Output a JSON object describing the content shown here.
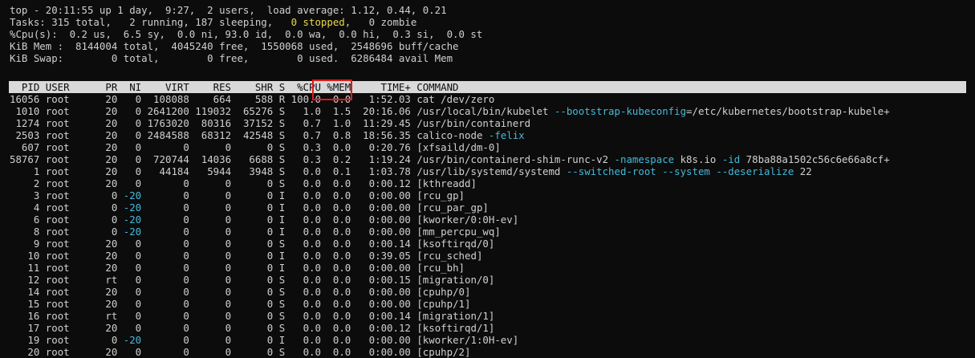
{
  "summary": {
    "l1": "top - 20:11:55 up 1 day,  9:27,  2 users,  load average: 1.12, 0.44, 0.21",
    "l2_pre": "Tasks: 315 total,   2 running, 187 sleeping,   ",
    "l2_stopped": "0 stopped",
    "l2_post": ",   0 zombie",
    "l3": "%Cpu(s):  0.2 us,  6.5 sy,  0.0 ni, 93.0 id,  0.0 wa,  0.0 hi,  0.3 si,  0.0 st",
    "l4": "KiB Mem :  8144004 total,  4045240 free,  1550068 used,  2548696 buff/cache",
    "l5": "KiB Swap:        0 total,        0 free,        0 used.  6286484 avail Mem"
  },
  "header": "  PID USER      PR  NI    VIRT    RES    SHR S  %CPU %MEM     TIME+ COMMAND",
  "rows": [
    {
      "pid": "16056",
      "user": "root",
      "pr": "20",
      "ni": "0",
      "virt": "108088",
      "res": "664",
      "shr": "588",
      "s": "R",
      "cpu": "100.0",
      "mem": "0.0",
      "time": "1:52.03",
      "cmd": [
        {
          "t": "cat /dev/zero",
          "c": ""
        }
      ]
    },
    {
      "pid": "1010",
      "user": "root",
      "pr": "20",
      "ni": "0",
      "virt": "2641200",
      "res": "119032",
      "shr": "65276",
      "s": "S",
      "cpu": "1.0",
      "mem": "1.5",
      "time": "20:16.06",
      "cmd": [
        {
          "t": "/usr/local/bin/kubelet ",
          "c": ""
        },
        {
          "t": "--bootstrap-kubeconfig",
          "c": "cyan"
        },
        {
          "t": "=/etc/kubernetes/bootstrap-kubele+",
          "c": ""
        }
      ]
    },
    {
      "pid": "1274",
      "user": "root",
      "pr": "20",
      "ni": "0",
      "virt": "1763020",
      "res": "80316",
      "shr": "37152",
      "s": "S",
      "cpu": "0.7",
      "mem": "1.0",
      "time": "11:29.45",
      "cmd": [
        {
          "t": "/usr/bin/containerd",
          "c": ""
        }
      ]
    },
    {
      "pid": "2503",
      "user": "root",
      "pr": "20",
      "ni": "0",
      "virt": "2484588",
      "res": "68312",
      "shr": "42548",
      "s": "S",
      "cpu": "0.7",
      "mem": "0.8",
      "time": "18:56.35",
      "cmd": [
        {
          "t": "calico-node ",
          "c": ""
        },
        {
          "t": "-felix",
          "c": "cyan"
        }
      ]
    },
    {
      "pid": "607",
      "user": "root",
      "pr": "20",
      "ni": "0",
      "virt": "0",
      "res": "0",
      "shr": "0",
      "s": "S",
      "cpu": "0.3",
      "mem": "0.0",
      "time": "0:20.76",
      "cmd": [
        {
          "t": "[xfsaild/dm-0]",
          "c": ""
        }
      ]
    },
    {
      "pid": "58767",
      "user": "root",
      "pr": "20",
      "ni": "0",
      "virt": "720744",
      "res": "14036",
      "shr": "6688",
      "s": "S",
      "cpu": "0.3",
      "mem": "0.2",
      "time": "1:19.24",
      "cmd": [
        {
          "t": "/usr/bin/containerd-shim-runc-v2 ",
          "c": ""
        },
        {
          "t": "-namespace",
          "c": "cyan"
        },
        {
          "t": " k8s.io ",
          "c": ""
        },
        {
          "t": "-id",
          "c": "cyan"
        },
        {
          "t": " 78ba88a1502c56c6e66a8cf+",
          "c": ""
        }
      ]
    },
    {
      "pid": "1",
      "user": "root",
      "pr": "20",
      "ni": "0",
      "virt": "44184",
      "res": "5944",
      "shr": "3948",
      "s": "S",
      "cpu": "0.0",
      "mem": "0.1",
      "time": "1:03.78",
      "cmd": [
        {
          "t": "/usr/lib/systemd/systemd ",
          "c": ""
        },
        {
          "t": "--switched-root --system --deserialize",
          "c": "cyan"
        },
        {
          "t": " 22",
          "c": ""
        }
      ]
    },
    {
      "pid": "2",
      "user": "root",
      "pr": "20",
      "ni": "0",
      "virt": "0",
      "res": "0",
      "shr": "0",
      "s": "S",
      "cpu": "0.0",
      "mem": "0.0",
      "time": "0:00.12",
      "cmd": [
        {
          "t": "[kthreadd]",
          "c": ""
        }
      ]
    },
    {
      "pid": "3",
      "user": "root",
      "pr": "0",
      "ni": "-20",
      "virt": "0",
      "res": "0",
      "shr": "0",
      "s": "I",
      "cpu": "0.0",
      "mem": "0.0",
      "time": "0:00.00",
      "cmd": [
        {
          "t": "[rcu_gp]",
          "c": ""
        }
      ]
    },
    {
      "pid": "4",
      "user": "root",
      "pr": "0",
      "ni": "-20",
      "virt": "0",
      "res": "0",
      "shr": "0",
      "s": "I",
      "cpu": "0.0",
      "mem": "0.0",
      "time": "0:00.00",
      "cmd": [
        {
          "t": "[rcu_par_gp]",
          "c": ""
        }
      ]
    },
    {
      "pid": "6",
      "user": "root",
      "pr": "0",
      "ni": "-20",
      "virt": "0",
      "res": "0",
      "shr": "0",
      "s": "I",
      "cpu": "0.0",
      "mem": "0.0",
      "time": "0:00.00",
      "cmd": [
        {
          "t": "[kworker/0:0H-ev]",
          "c": ""
        }
      ]
    },
    {
      "pid": "8",
      "user": "root",
      "pr": "0",
      "ni": "-20",
      "virt": "0",
      "res": "0",
      "shr": "0",
      "s": "I",
      "cpu": "0.0",
      "mem": "0.0",
      "time": "0:00.00",
      "cmd": [
        {
          "t": "[mm_percpu_wq]",
          "c": ""
        }
      ]
    },
    {
      "pid": "9",
      "user": "root",
      "pr": "20",
      "ni": "0",
      "virt": "0",
      "res": "0",
      "shr": "0",
      "s": "S",
      "cpu": "0.0",
      "mem": "0.0",
      "time": "0:00.14",
      "cmd": [
        {
          "t": "[ksoftirqd/0]",
          "c": ""
        }
      ]
    },
    {
      "pid": "10",
      "user": "root",
      "pr": "20",
      "ni": "0",
      "virt": "0",
      "res": "0",
      "shr": "0",
      "s": "I",
      "cpu": "0.0",
      "mem": "0.0",
      "time": "0:39.05",
      "cmd": [
        {
          "t": "[rcu_sched]",
          "c": ""
        }
      ]
    },
    {
      "pid": "11",
      "user": "root",
      "pr": "20",
      "ni": "0",
      "virt": "0",
      "res": "0",
      "shr": "0",
      "s": "I",
      "cpu": "0.0",
      "mem": "0.0",
      "time": "0:00.00",
      "cmd": [
        {
          "t": "[rcu_bh]",
          "c": ""
        }
      ]
    },
    {
      "pid": "12",
      "user": "root",
      "pr": "rt",
      "ni": "0",
      "virt": "0",
      "res": "0",
      "shr": "0",
      "s": "S",
      "cpu": "0.0",
      "mem": "0.0",
      "time": "0:00.15",
      "cmd": [
        {
          "t": "[migration/0]",
          "c": ""
        }
      ]
    },
    {
      "pid": "14",
      "user": "root",
      "pr": "20",
      "ni": "0",
      "virt": "0",
      "res": "0",
      "shr": "0",
      "s": "S",
      "cpu": "0.0",
      "mem": "0.0",
      "time": "0:00.00",
      "cmd": [
        {
          "t": "[cpuhp/0]",
          "c": ""
        }
      ]
    },
    {
      "pid": "15",
      "user": "root",
      "pr": "20",
      "ni": "0",
      "virt": "0",
      "res": "0",
      "shr": "0",
      "s": "S",
      "cpu": "0.0",
      "mem": "0.0",
      "time": "0:00.00",
      "cmd": [
        {
          "t": "[cpuhp/1]",
          "c": ""
        }
      ]
    },
    {
      "pid": "16",
      "user": "root",
      "pr": "rt",
      "ni": "0",
      "virt": "0",
      "res": "0",
      "shr": "0",
      "s": "S",
      "cpu": "0.0",
      "mem": "0.0",
      "time": "0:00.14",
      "cmd": [
        {
          "t": "[migration/1]",
          "c": ""
        }
      ]
    },
    {
      "pid": "17",
      "user": "root",
      "pr": "20",
      "ni": "0",
      "virt": "0",
      "res": "0",
      "shr": "0",
      "s": "S",
      "cpu": "0.0",
      "mem": "0.0",
      "time": "0:00.12",
      "cmd": [
        {
          "t": "[ksoftirqd/1]",
          "c": ""
        }
      ]
    },
    {
      "pid": "19",
      "user": "root",
      "pr": "0",
      "ni": "-20",
      "virt": "0",
      "res": "0",
      "shr": "0",
      "s": "I",
      "cpu": "0.0",
      "mem": "0.0",
      "time": "0:00.00",
      "cmd": [
        {
          "t": "[kworker/1:0H-ev]",
          "c": ""
        }
      ]
    },
    {
      "pid": "20",
      "user": "root",
      "pr": "20",
      "ni": "0",
      "virt": "0",
      "res": "0",
      "shr": "0",
      "s": "S",
      "cpu": "0.0",
      "mem": "0.0",
      "time": "0:00.00",
      "cmd": [
        {
          "t": "[cpuhp/2]",
          "c": ""
        }
      ]
    }
  ],
  "colors": {
    "background": "#0c0c0c",
    "text": "#d0d0d0",
    "header_bg": "#d9d9d9",
    "stopped_yellow": "#e8d84a",
    "option_cyan": "#45b8d8",
    "highlight_box": "#e01818"
  }
}
